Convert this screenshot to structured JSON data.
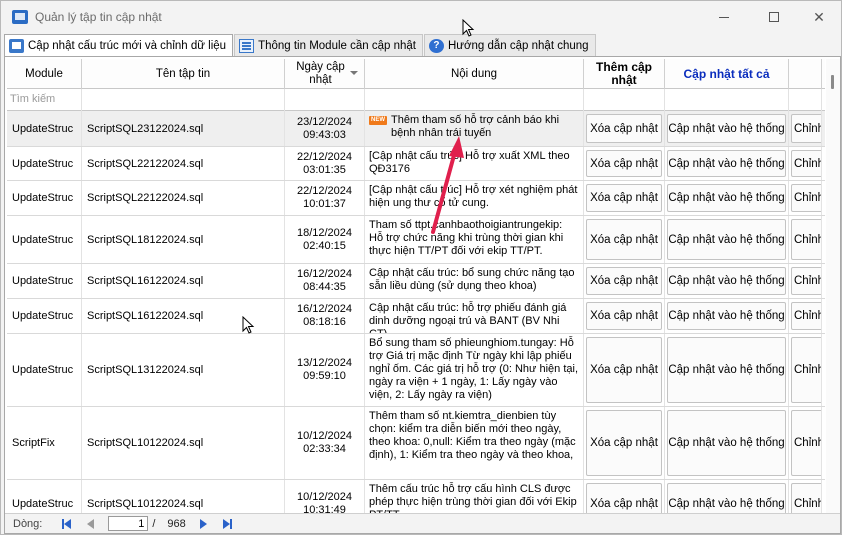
{
  "window": {
    "title": "Quản lý tập tin cập nhật"
  },
  "tabs": [
    {
      "label": "Cập nhật cấu trúc mới và chỉnh dữ liệu",
      "icon": "form-window-icon",
      "active": true
    },
    {
      "label": "Thông tin Module cần cập nhật",
      "icon": "list-window-icon",
      "active": false
    },
    {
      "label": "Hướng dẫn cập nhật chung",
      "icon": "help-icon",
      "active": false
    }
  ],
  "grid": {
    "headers": {
      "module": "Module",
      "file": "Tên tập tin",
      "date": "Ngày cập nhật",
      "content": "Nội dung",
      "add": "Thêm cập nhật",
      "update_all": "Cập nhật tất cả"
    },
    "filter_placeholder": "Tìm kiếm",
    "rows": [
      {
        "module": "UpdateStruc",
        "file": "ScriptSQL23122024.sql",
        "date": "23/12/2024",
        "time": "09:43:03",
        "content": "Thêm tham số hỗ trợ cảnh báo khi bệnh nhân trái tuyến",
        "is_new": true,
        "new_label": "NEW",
        "btn_delete": "Xóa cập nhật",
        "btn_apply": "Cập nhật vào hệ thống",
        "btn_edit": "Chỉnh"
      },
      {
        "module": "UpdateStruc",
        "file": "ScriptSQL22122024.sql",
        "date": "22/12/2024",
        "time": "03:01:35",
        "content": "[Cập nhật cấu trúc] Hỗ trợ xuất XML theo QĐ3176",
        "btn_delete": "Xóa cập nhật",
        "btn_apply": "Cập nhật vào hệ thống",
        "btn_edit": "Chỉnh"
      },
      {
        "module": "UpdateStruc",
        "file": "ScriptSQL22122024.sql",
        "date": "22/12/2024",
        "time": "10:01:37",
        "content": "[Cập nhật cấu trúc] Hỗ trợ xét nghiệm phát hiện ung thư cổ tử cung.",
        "btn_delete": "Xóa cập nhật",
        "btn_apply": "Cập nhật vào hệ thống",
        "btn_edit": "Chỉnh"
      },
      {
        "module": "UpdateStruc",
        "file": "ScriptSQL18122024.sql",
        "date": "18/12/2024",
        "time": "02:40:15",
        "content": "Tham số ttpt.canhbaothoigiantrungekip: Hỗ trợ chức năng khi trùng thời gian khi thực hiện TT/PT đối với ekip TT/PT.",
        "btn_delete": "Xóa cập nhật",
        "btn_apply": "Cập nhật vào hệ thống",
        "btn_edit": "Chỉnh"
      },
      {
        "module": "UpdateStruc",
        "file": "ScriptSQL16122024.sql",
        "date": "16/12/2024",
        "time": "08:44:35",
        "content": "Cập nhật cấu trúc: bổ sung chức năng tạo sẵn liều dùng (sử dụng theo khoa)",
        "btn_delete": "Xóa cập nhật",
        "btn_apply": "Cập nhật vào hệ thống",
        "btn_edit": "Chỉnh"
      },
      {
        "module": "UpdateStruc",
        "file": "ScriptSQL16122024.sql",
        "date": "16/12/2024",
        "time": "08:18:16",
        "content": "Cập nhật cấu trúc: hỗ trợ phiếu đánh giá dinh dưỡng ngoại trú và BANT (BV Nhi CT)",
        "btn_delete": "Xóa cập nhật",
        "btn_apply": "Cập nhật vào hệ thống",
        "btn_edit": "Chỉnh"
      },
      {
        "module": "UpdateStruc",
        "file": "ScriptSQL13122024.sql",
        "date": "13/12/2024",
        "time": "09:59:10",
        "content": "Bổ sung tham số phieunghiom.tungay: Hỗ trợ Giá trị mặc định Từ ngày khi lập phiếu nghỉ ốm. Các giá trị hỗ trợ (0: Như hiện tại, ngày ra viện + 1 ngày, 1: Lấy ngày vào viện, 2: Lấy ngày ra viện)",
        "btn_delete": "Xóa cập nhật",
        "btn_apply": "Cập nhật vào hệ thống",
        "btn_edit": "Chỉnh"
      },
      {
        "module": "ScriptFix",
        "file": "ScriptSQL10122024.sql",
        "date": "10/12/2024",
        "time": "02:33:34",
        "content": "Thêm tham số nt.kiemtra_dienbien tùy chọn: kiểm tra diễn biến mới theo ngày, theo khoa: 0,null: Kiểm tra theo ngày (mặc định), 1: Kiểm tra theo ngày và theo khoa,",
        "btn_delete": "Xóa cập nhật",
        "btn_apply": "Cập nhật vào hệ thống",
        "btn_edit": "Chỉnh"
      },
      {
        "module": "UpdateStruc",
        "file": "ScriptSQL10122024.sql",
        "date": "10/12/2024",
        "time": "10:31:49",
        "content": "Thêm cấu trúc hỗ trợ cấu hình CLS được phép thực hiện trùng thời gian đối với Ekip PT/TT",
        "btn_delete": "Xóa cập nhật",
        "btn_apply": "Cập nhật vào hệ thống",
        "btn_edit": "Chỉnh"
      }
    ]
  },
  "footer": {
    "row_label": "Dòng:",
    "current": "1",
    "separator": "/",
    "total": "968"
  }
}
